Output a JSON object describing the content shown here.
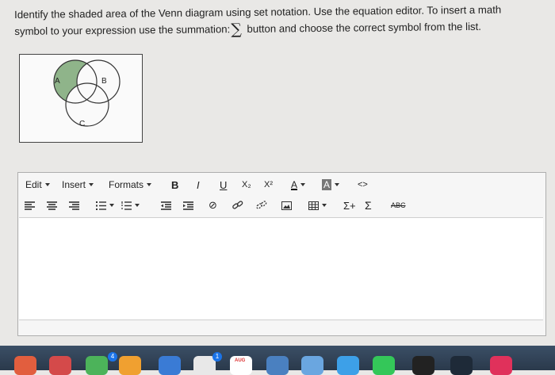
{
  "question": {
    "line1": "Identify the shaded area of the Venn diagram using set notation. Use the equation editor. To insert a math",
    "line2_before": "symbol to your expression use the summation:",
    "sigma_symbol": "∑",
    "line2_after": "button and choose the correct symbol from the list."
  },
  "venn": {
    "label_a": "A",
    "label_b": "B",
    "label_c": "C",
    "shaded_color": "#8fb48a"
  },
  "editor": {
    "menus": {
      "edit": "Edit",
      "insert": "Insert",
      "formats": "Formats"
    },
    "toolbar": {
      "bold": "B",
      "italic": "I",
      "underline": "U",
      "subscript": "X₂",
      "superscript": "X²",
      "font_color": "A",
      "highlight": "A",
      "source": "<>",
      "sigma_plus": "Σ+",
      "sigma": "Σ",
      "spell": "ABC"
    }
  },
  "taskbar": {
    "badge_1": "4",
    "badge_2": "1",
    "calendar_label": "AUG"
  }
}
